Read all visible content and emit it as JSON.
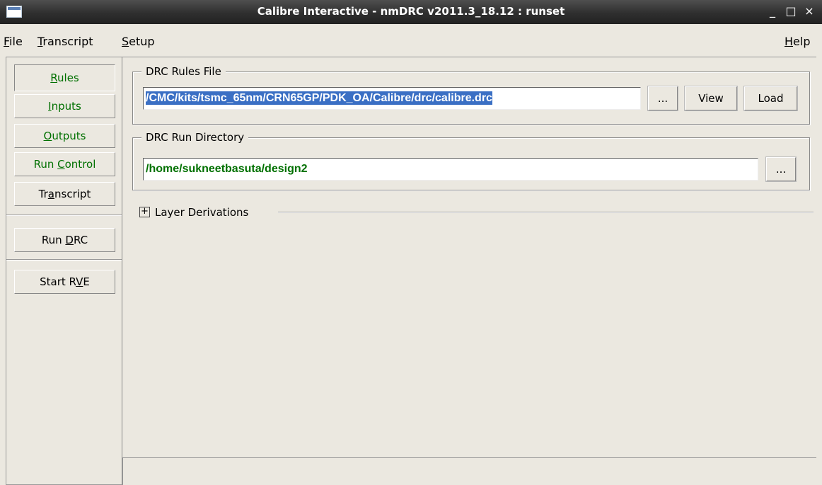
{
  "window": {
    "title": "Calibre Interactive - nmDRC v2011.3_18.12 : runset",
    "minimize": "_",
    "maximize": "□",
    "close": "×"
  },
  "menu": {
    "file_key": "F",
    "file_rest": "ile",
    "transcript_key": "T",
    "transcript_rest": "ranscript",
    "setup_key": "S",
    "setup_rest": "etup",
    "help_key": "H",
    "help_rest": "elp"
  },
  "nav": {
    "rules_key": "R",
    "rules_rest": "ules",
    "inputs_key": "I",
    "inputs_rest": "nputs",
    "outputs_key": "O",
    "outputs_rest": "utputs",
    "runcontrol_pre": "Run ",
    "runcontrol_key": "C",
    "runcontrol_rest": "ontrol",
    "transcript_pre": "Tr",
    "transcript_key": "a",
    "transcript_rest": "nscript",
    "rundrc_pre": "Run ",
    "rundrc_key": "D",
    "rundrc_rest": "RC",
    "startrve_pre": "Start R",
    "startrve_key": "V",
    "startrve_rest": "E"
  },
  "rules_file": {
    "label": "DRC Rules File",
    "value": "/CMC/kits/tsmc_65nm/CRN65GP/PDK_OA/Calibre/drc/calibre.drc",
    "browse": "...",
    "view": "View",
    "load": "Load"
  },
  "run_dir": {
    "label": "DRC Run Directory",
    "value": "/home/sukneetbasuta/design2",
    "browse": "..."
  },
  "layer_derivations": {
    "expander": "+",
    "label": "Layer Derivations"
  },
  "colors": {
    "accent_green": "#007000",
    "selection_blue": "#3a6fc4",
    "background": "#ebe8e0"
  }
}
